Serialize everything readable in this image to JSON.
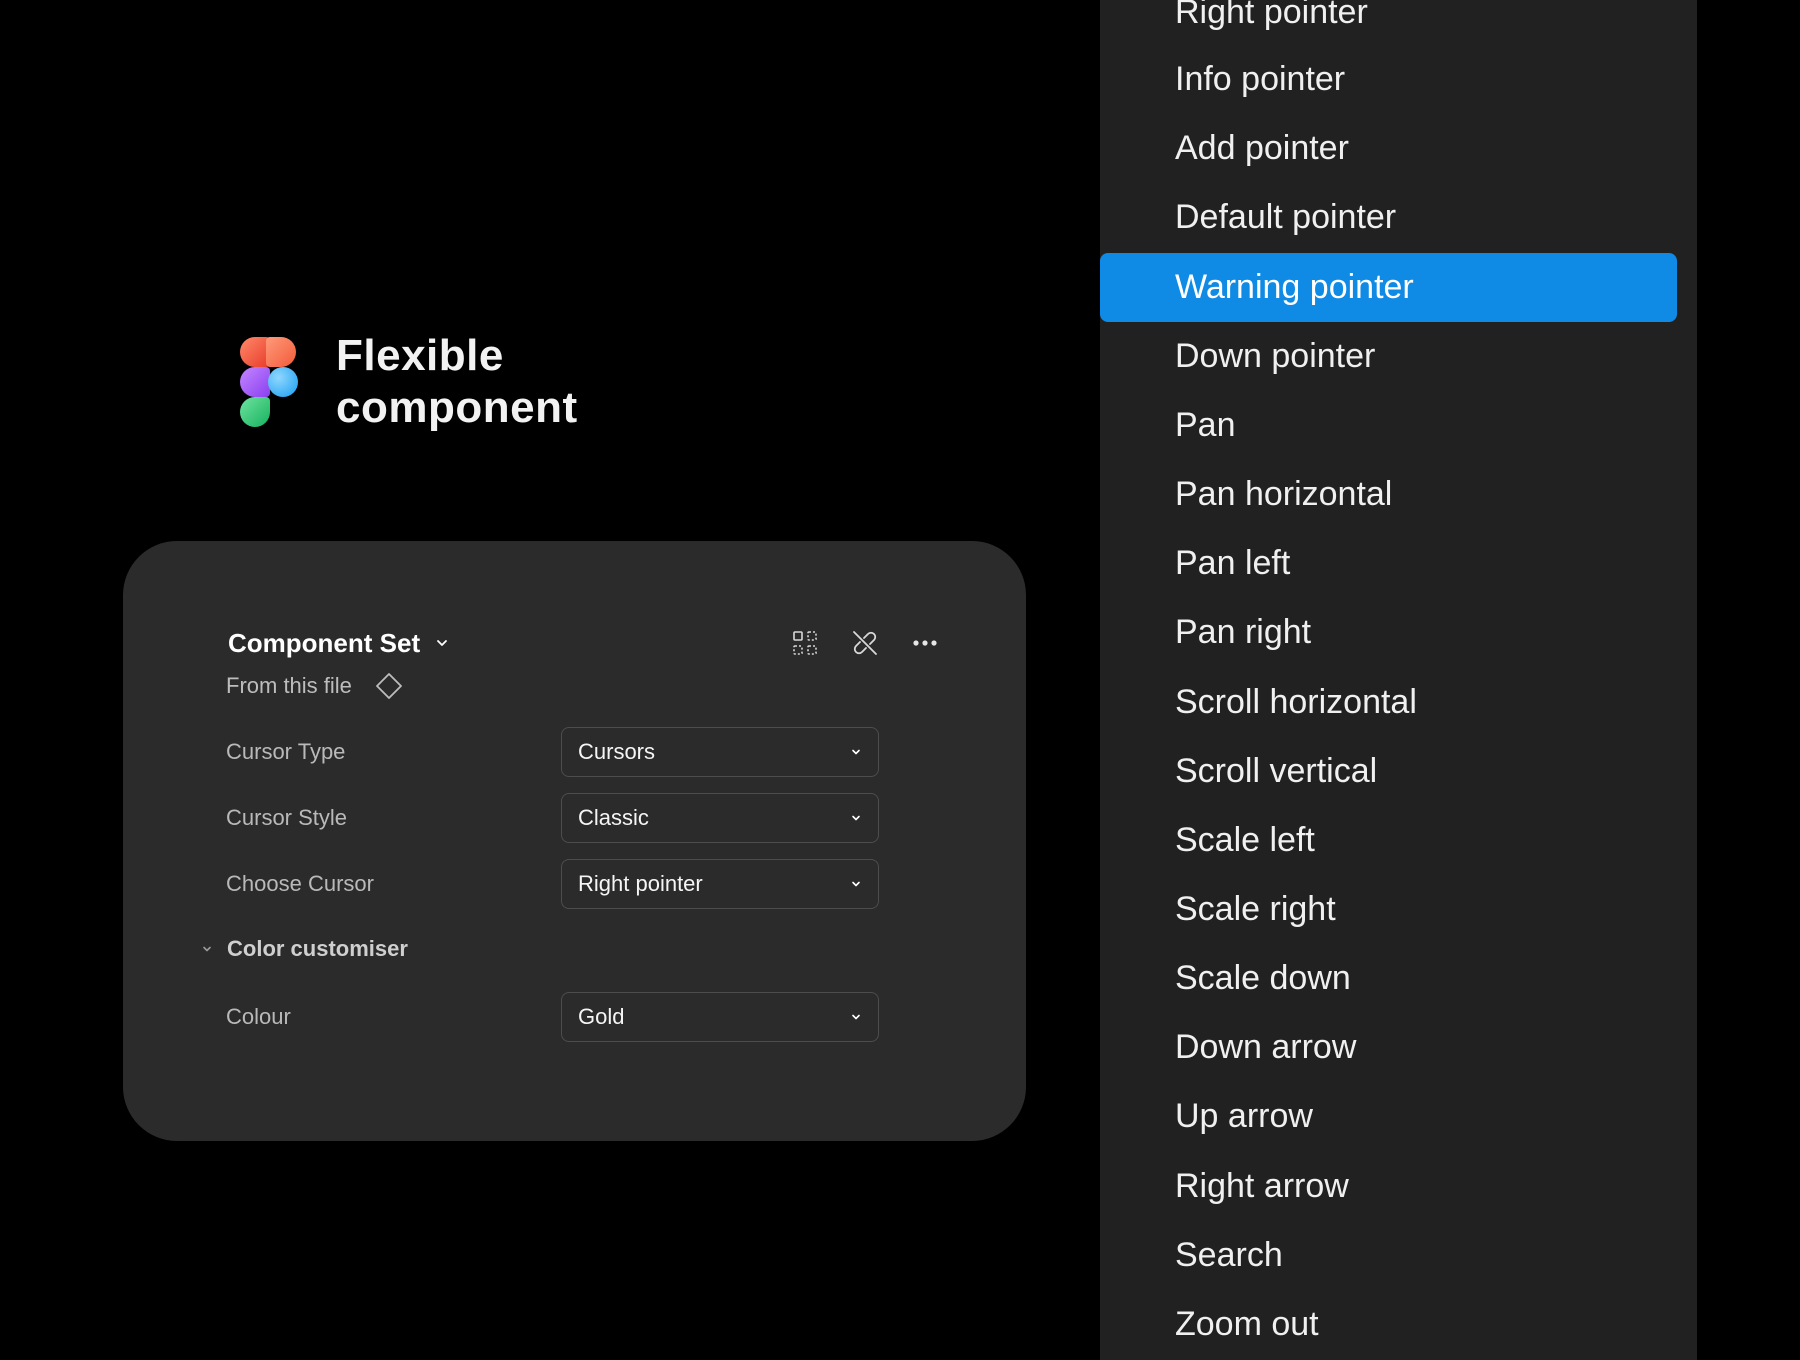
{
  "brand": {
    "title_line1": "Flexible",
    "title_line2": "component",
    "logo_icon": "figma-logo"
  },
  "panel": {
    "title": "Component Set",
    "source_label": "From this file",
    "header_icons": [
      "component-grid-icon",
      "detach-instance-icon",
      "more-options-icon"
    ],
    "properties": [
      {
        "label": "Cursor Type",
        "value": "Cursors"
      },
      {
        "label": "Cursor Style",
        "value": "Classic"
      },
      {
        "label": "Choose Cursor",
        "value": "Right pointer"
      }
    ],
    "section": {
      "label": "Color customiser",
      "properties": [
        {
          "label": "Colour",
          "value": "Gold"
        }
      ]
    }
  },
  "menu": {
    "items": [
      "Right pointer",
      "Info pointer",
      "Add pointer",
      "Default pointer",
      "Warning pointer",
      "Down pointer",
      "Pan",
      "Pan horizontal",
      "Pan left",
      "Pan right",
      "Scroll horizontal",
      "Scroll vertical",
      "Scale left",
      "Scale right",
      "Scale down",
      "Down arrow",
      "Up arrow",
      "Right arrow",
      "Search",
      "Zoom out"
    ],
    "selected": "Warning pointer"
  },
  "colors": {
    "background": "#000000",
    "panel": "#2b2b2b",
    "menu": "#212121",
    "selection": "#0f8be6"
  }
}
